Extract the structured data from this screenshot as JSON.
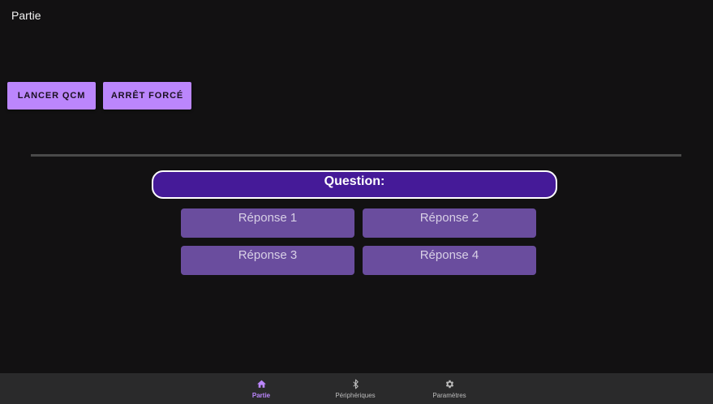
{
  "header": {
    "title": "Partie"
  },
  "toolbar": {
    "start_label": "LANCER QCM",
    "stop_label": "ARRÊT FORCÉ"
  },
  "quiz": {
    "question_label": "Question:",
    "answers": [
      "Réponse 1",
      "Réponse 2",
      "Réponse 3",
      "Réponse 4"
    ]
  },
  "bottom_nav": {
    "items": [
      {
        "label": "Partie",
        "icon": "home-icon",
        "active": true
      },
      {
        "label": "Périphériques",
        "icon": "bluetooth-icon",
        "active": false
      },
      {
        "label": "Paramètres",
        "icon": "gear-icon",
        "active": false
      }
    ]
  },
  "colors": {
    "accent": "#bb86fc",
    "question_bg": "#451a98",
    "answer_bg": "#6a4d9e",
    "background": "#121112",
    "nav_bg": "#2a2a2b"
  }
}
